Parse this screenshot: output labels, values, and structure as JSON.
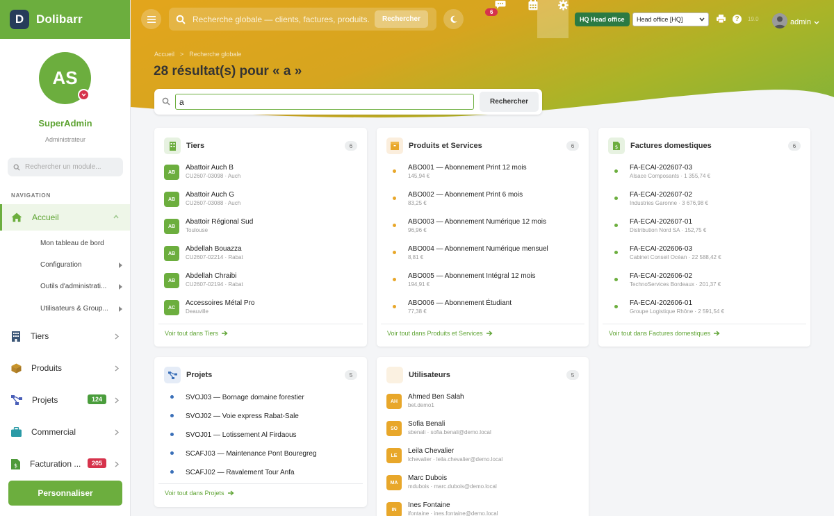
{
  "app": {
    "name": "Dolibarr"
  },
  "user": {
    "initials": "AS",
    "name": "SuperAdmin",
    "role": "Administrateur"
  },
  "sidebar": {
    "search_placeholder": "Rechercher un module...",
    "section_title": "NAVIGATION",
    "items": [
      {
        "label": "Accueil"
      },
      {
        "label": "Tiers"
      },
      {
        "label": "Produits"
      },
      {
        "label": "Projets",
        "badge": "124",
        "badge_color": "#4a9d3c"
      },
      {
        "label": "Commercial"
      },
      {
        "label": "Facturation ...",
        "badge": "205",
        "badge_color": "#d6334c"
      }
    ],
    "sub_items": [
      {
        "label": "Mon tableau de bord"
      },
      {
        "label": "Configuration"
      },
      {
        "label": "Outils d'administrati..."
      },
      {
        "label": "Utilisateurs & Group..."
      }
    ],
    "personalize_label": "Personnaliser"
  },
  "topbar": {
    "search_placeholder": "Recherche globale — clients, factures, produits...",
    "search_button": "Rechercher",
    "chat_badge": "6",
    "entity_badge": "HQ Head office",
    "entity_select": "Head office [HQ]",
    "version": "19.0",
    "admin_name": "admin"
  },
  "breadcrumb": {
    "home": "Accueil",
    "separator": ">",
    "current": "Recherche globale"
  },
  "page": {
    "title": "28 résultat(s) pour « a »"
  },
  "search": {
    "value": "a",
    "button": "Rechercher"
  },
  "colors": {
    "green": "#6cae3e",
    "orange": "#e8a72a",
    "blue": "#3a6fb8",
    "red": "#d6334c"
  },
  "cards": {
    "tiers": {
      "title": "Tiers",
      "count": "6",
      "see_all": "Voir tout dans Tiers",
      "items": [
        {
          "initials": "AB",
          "title": "Abattoir Auch B",
          "sub": "CU2607-03098 · Auch"
        },
        {
          "initials": "AB",
          "title": "Abattoir Auch G",
          "sub": "CU2607-03088 · Auch"
        },
        {
          "initials": "AB",
          "title": "Abattoir Régional Sud",
          "sub": "Toulouse"
        },
        {
          "initials": "AB",
          "title": "Abdellah Bouazza",
          "sub": "CU2607-02214 · Rabat"
        },
        {
          "initials": "AB",
          "title": "Abdellah Chraibi",
          "sub": "CU2607-02194 · Rabat"
        },
        {
          "initials": "AC",
          "title": "Accessoires Métal Pro",
          "sub": "Deauville"
        }
      ]
    },
    "products": {
      "title": "Produits et Services",
      "count": "6",
      "see_all": "Voir tout dans Produits et Services",
      "items": [
        {
          "title": "ABO001 — Abonnement Print 12 mois",
          "sub": "145,94 €"
        },
        {
          "title": "ABO002 — Abonnement Print 6 mois",
          "sub": "83,25 €"
        },
        {
          "title": "ABO003 — Abonnement Numérique 12 mois",
          "sub": "96,96 €"
        },
        {
          "title": "ABO004 — Abonnement Numérique mensuel",
          "sub": "8,81 €"
        },
        {
          "title": "ABO005 — Abonnement Intégral 12 mois",
          "sub": "194,91 €"
        },
        {
          "title": "ABO006 — Abonnement Étudiant",
          "sub": "77,38 €"
        }
      ]
    },
    "invoices": {
      "title": "Factures domestiques",
      "count": "6",
      "see_all": "Voir tout dans Factures domestiques",
      "items": [
        {
          "title": "FA-ECAI-202607-03",
          "sub": "Alsace Composants · 1 355,74 €"
        },
        {
          "title": "FA-ECAI-202607-02",
          "sub": "Industries Garonne · 3 676,98 €"
        },
        {
          "title": "FA-ECAI-202607-01",
          "sub": "Distribution Nord SA · 152,75 €"
        },
        {
          "title": "FA-ECAI-202606-03",
          "sub": "Cabinet Conseil Océan · 22 588,42 €"
        },
        {
          "title": "FA-ECAI-202606-02",
          "sub": "TechnoServices Bordeaux · 201,37 €"
        },
        {
          "title": "FA-ECAI-202606-01",
          "sub": "Groupe Logistique Rhône · 2 591,54 €"
        }
      ]
    },
    "projects": {
      "title": "Projets",
      "count": "5",
      "see_all": "Voir tout dans Projets",
      "items": [
        {
          "title": "SVOJ03 — Bornage domaine forestier"
        },
        {
          "title": "SVOJ02 — Voie express Rabat-Sale"
        },
        {
          "title": "SVOJ01 — Lotissement Al Firdaous"
        },
        {
          "title": "SCAFJ03 — Maintenance Pont Bouregreg"
        },
        {
          "title": "SCAFJ02 — Ravalement Tour Anfa"
        }
      ]
    },
    "users": {
      "title": "Utilisateurs",
      "count": "5",
      "items": [
        {
          "initials": "AH",
          "title": "Ahmed Ben Salah",
          "sub": "bet.demo1"
        },
        {
          "initials": "SO",
          "title": "Sofia Benali",
          "sub": "sbenali · sofia.benali@demo.local"
        },
        {
          "initials": "LE",
          "title": "Leila Chevalier",
          "sub": "lchevalier · leila.chevalier@demo.local"
        },
        {
          "initials": "MA",
          "title": "Marc Dubois",
          "sub": "mdubois · marc.dubois@demo.local"
        },
        {
          "initials": "IN",
          "title": "Ines Fontaine",
          "sub": "ifontaine · ines.fontaine@demo.local"
        }
      ]
    }
  }
}
